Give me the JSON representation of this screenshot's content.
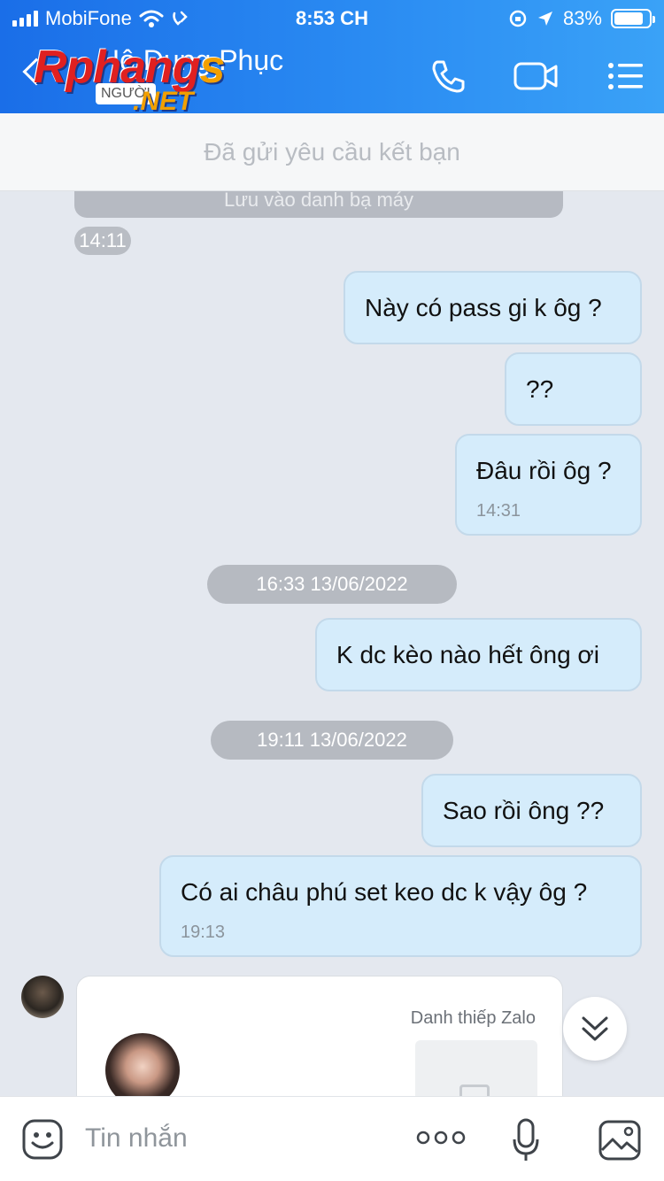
{
  "status_bar": {
    "carrier": "MobiFone",
    "time": "8:53 CH",
    "battery": "83%",
    "battery_level": 0.83
  },
  "header": {
    "contact_name": "Hô Dung Phục",
    "logo_text": "Rphangs",
    "logo_tag": "NGƯỜI",
    "logo_net": ".NET",
    "call_icon": "phone-icon",
    "video_icon": "video-icon",
    "menu_icon": "menu-icon"
  },
  "banner": {
    "text": "Đã gửi yêu cầu kết bạn"
  },
  "chat": {
    "prev_card_text": "Lưu vào danh bạ máy",
    "prev_time": "14:11",
    "messages": [
      {
        "text": "Này có pass gi k ôg ?"
      },
      {
        "text": "??"
      },
      {
        "text": "Đâu rồi ôg ?",
        "time": "14:31"
      },
      {
        "date": "16:33 13/06/2022"
      },
      {
        "text": "K dc kèo nào hết ông ơi"
      },
      {
        "date": "19:11 13/06/2022"
      },
      {
        "text": "Sao rồi ông ??"
      },
      {
        "text": "Có ai châu phú set keo dc k vậy ôg ?",
        "time": "19:13"
      }
    ],
    "card_label": "Danh thiếp Zalo"
  },
  "input": {
    "placeholder": "Tin nhắn"
  },
  "colors": {
    "header_start": "#1a6ee8",
    "header_end": "#3aa2f7",
    "bubble": "#d5ecfb",
    "chat_bg": "#e4e8ef"
  }
}
